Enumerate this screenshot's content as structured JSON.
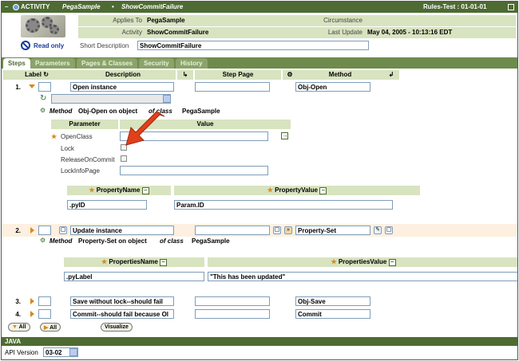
{
  "title": {
    "type": "ACTIVITY",
    "class": "PegaSample",
    "name": "ShowCommitFailure",
    "ruleset": "Rules-Test : 01-01-01"
  },
  "header": {
    "applies_to_label": "Applies To",
    "applies_to_value": "PegaSample",
    "activity_label": "Activity",
    "activity_value": "ShowCommitFailure",
    "circumstance_label": "Circumstance",
    "last_update_label": "Last Update",
    "last_update_value": "May 04, 2005 - 10:13:16 EDT",
    "read_only": "Read only",
    "short_desc_label": "Short Description",
    "short_desc_value": "ShowCommitFailure"
  },
  "tabs": [
    "Steps",
    "Parameters",
    "Pages & Classes",
    "Security",
    "History"
  ],
  "columns": {
    "label": "Label",
    "description": "Description",
    "step_page": "Step Page",
    "method": "Method"
  },
  "steps": [
    {
      "num": "1.",
      "description": "Open instance",
      "method": "Obj-Open"
    },
    {
      "num": "2.",
      "description": "Update instance",
      "method": "Property-Set"
    },
    {
      "num": "3.",
      "description": "Save without lock--should fail",
      "method": "Obj-Save"
    },
    {
      "num": "4.",
      "description": "Commit--should fail because Ol",
      "method": "Commit"
    }
  ],
  "step1_detail": {
    "method_word": "Method",
    "method_name": "Obj-Open on object",
    "of_class": "of class",
    "class_name": "PegaSample",
    "param_header": "Parameter",
    "value_header": "Value",
    "params": [
      "OpenClass",
      "Lock",
      "ReleaseOnCommit",
      "LockInfoPage"
    ],
    "prop_name_header": "PropertyName",
    "prop_value_header": "PropertyValue",
    "prop_name": ".pyID",
    "prop_value": "Param.ID"
  },
  "step2_detail": {
    "method_word": "Method",
    "method_name": "Property-Set on object",
    "of_class": "of class",
    "class_name": "PegaSample",
    "prop_name_header": "PropertiesName",
    "prop_value_header": "PropertiesValue",
    "prop_name": ".pyLabel",
    "prop_value": "\"This has been updated\""
  },
  "buttons": {
    "all1": "All",
    "all2": "All",
    "visualize": "Visualize"
  },
  "java": {
    "section": "JAVA",
    "api_label": "API Version",
    "api_value": "03-02"
  },
  "colors": {
    "accent": "#4d6b32",
    "header_bg": "#d8e3c0",
    "arrow": "#e0401a"
  }
}
